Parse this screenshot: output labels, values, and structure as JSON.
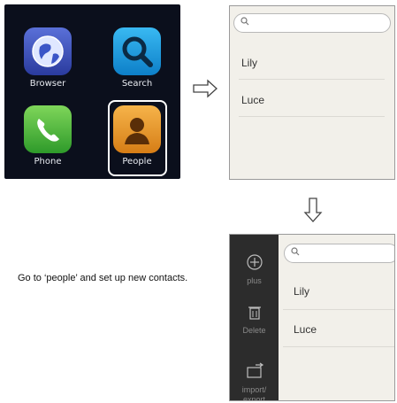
{
  "home": {
    "apps": [
      {
        "label": "Browser",
        "icon": "globe-icon"
      },
      {
        "label": "Search",
        "icon": "magnifier-icon"
      },
      {
        "label": "Phone",
        "icon": "phone-icon"
      },
      {
        "label": "People",
        "icon": "person-icon"
      }
    ]
  },
  "screen1": {
    "search_icon": "search-icon",
    "contacts": [
      "Lily",
      "Luce"
    ]
  },
  "screen2": {
    "search_icon": "search-icon",
    "sidebar": [
      {
        "label": "plus",
        "icon": "plus-icon"
      },
      {
        "label": "Delete",
        "icon": "trash-icon"
      },
      {
        "label": "import/ export",
        "icon": "import-export-icon"
      }
    ],
    "contacts": [
      "Lily",
      "Luce"
    ]
  },
  "instruction": "Go to ‘people’ and set up new contacts.",
  "colors": {
    "home_bg": "#0b0f1c",
    "sidebar_bg": "#2c2c2c",
    "list_bg": "#f2f0ea"
  }
}
